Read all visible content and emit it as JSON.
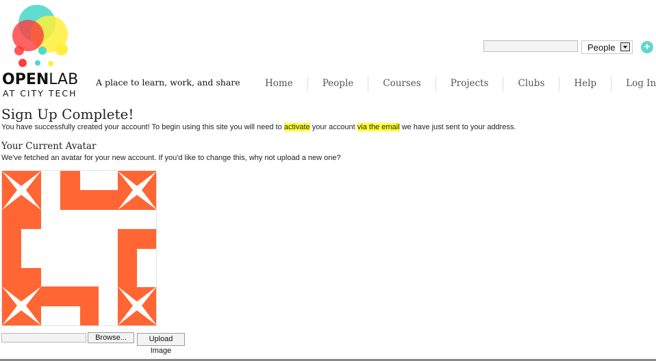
{
  "logo": {
    "word_bold": "OPEN",
    "word_light": "LAB",
    "subtitle": "AT CITY TECH",
    "tagline": "A place to learn, work, and share",
    "colors": [
      "#4fd8cc",
      "#ff3b3b",
      "#ffef3a"
    ]
  },
  "search": {
    "input_value": "",
    "select_value": "People",
    "plus_icon": "+"
  },
  "nav": {
    "items": [
      {
        "label": "Home"
      },
      {
        "label": "People"
      },
      {
        "label": "Courses"
      },
      {
        "label": "Projects"
      },
      {
        "label": "Clubs"
      },
      {
        "label": "Help"
      },
      {
        "label": "Log In"
      }
    ]
  },
  "content": {
    "title": "Sign Up Complete!",
    "message_part1": "You have successfully created your account! To begin using this site you will need to ",
    "message_highlight1": "activate",
    "message_part2": " your account ",
    "message_highlight2": "via the email",
    "message_part3": " we have just sent to your address.",
    "avatar_title": "Your Current Avatar",
    "avatar_message": "We've fetched an avatar for your new account. If you'd like to change this, why not upload a new one?",
    "avatar_color": "#ff6633",
    "highlight_color": "#ffff33"
  },
  "upload": {
    "file_value": "",
    "browse_label": "Browse...",
    "upload_label": "Upload Image"
  }
}
